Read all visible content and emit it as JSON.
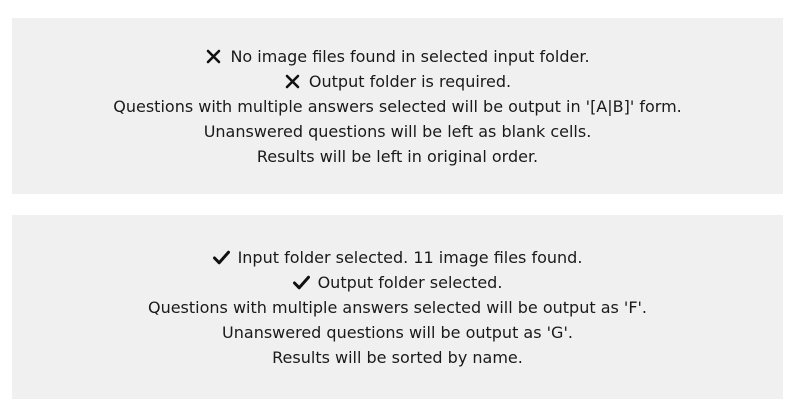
{
  "invalid_panel": {
    "lines": [
      {
        "icon": "x-mark-icon",
        "text": "No image files found in selected input folder."
      },
      {
        "icon": "x-mark-icon",
        "text": "Output folder is required."
      },
      {
        "text": "Questions with multiple answers selected will be output in '[A|B]' form."
      },
      {
        "text": "Unanswered questions will be left as blank cells."
      },
      {
        "text": "Results will be left in original order."
      }
    ]
  },
  "valid_panel": {
    "lines": [
      {
        "icon": "check-mark-icon",
        "text": "Input folder selected. 11 image files found."
      },
      {
        "icon": "check-mark-icon",
        "text": "Output folder selected."
      },
      {
        "text": "Questions with multiple answers selected will be output as 'F'."
      },
      {
        "text": "Unanswered questions will be output as 'G'."
      },
      {
        "text": "Results will be sorted by name."
      }
    ]
  },
  "colors": {
    "panel_background": "#f0f0f0",
    "text": "#1a1a1a",
    "icon": "#111111"
  }
}
